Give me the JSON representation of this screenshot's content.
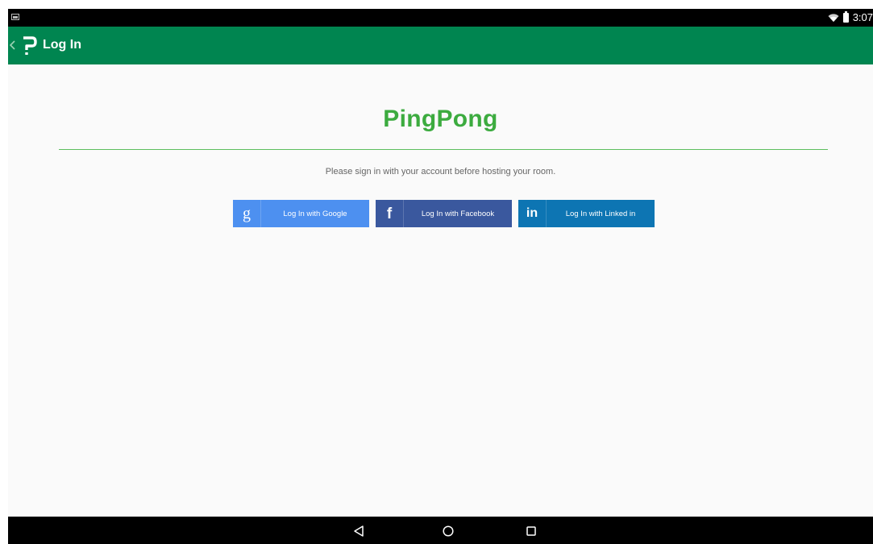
{
  "status_bar": {
    "time": "3:07"
  },
  "app_bar": {
    "title": "Log In"
  },
  "brand": {
    "name": "PingPong"
  },
  "content": {
    "subtitle": "Please sign in with your account before hosting your room."
  },
  "buttons": {
    "google": {
      "label": "Log In with Google",
      "icon_glyph": "g",
      "color": "#4d90f0"
    },
    "facebook": {
      "label": "Log In with Facebook",
      "icon_glyph": "f",
      "color": "#3a589e"
    },
    "linkedin": {
      "label": "Log In with Linked in",
      "icon_glyph": "in",
      "color": "#0d75b3"
    }
  },
  "colors": {
    "app_bar": "#008550",
    "brand": "#3cab3f",
    "background": "#fafafa"
  }
}
